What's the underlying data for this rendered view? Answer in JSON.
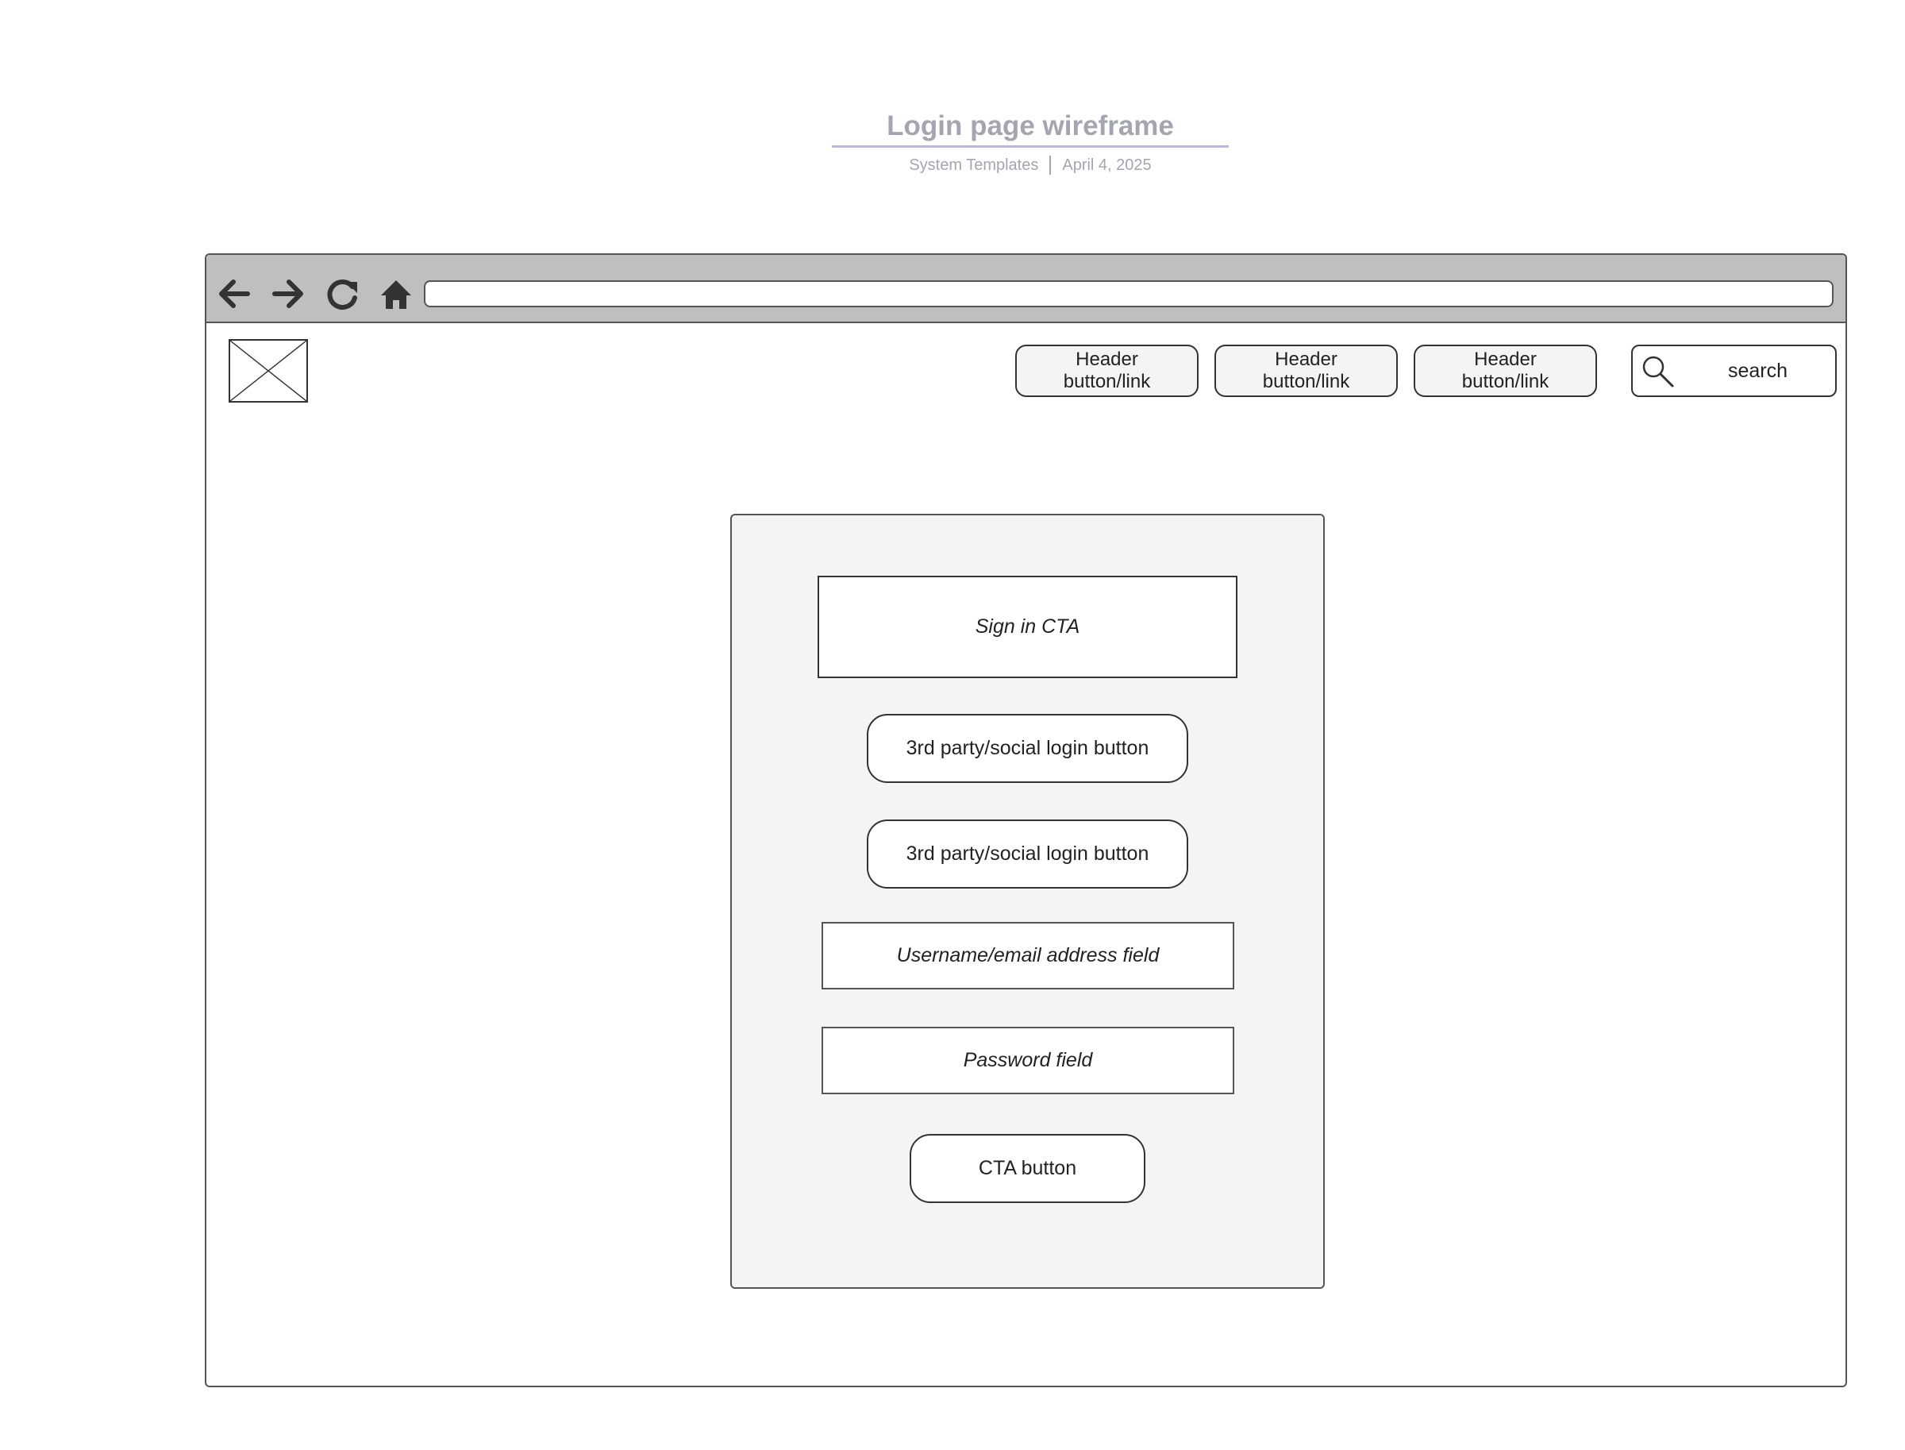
{
  "diagram": {
    "title": "Login page wireframe",
    "source": "System Templates",
    "date": "April 4, 2025"
  },
  "browser": {
    "icons": [
      "back-arrow-icon",
      "forward-arrow-icon",
      "reload-icon",
      "home-icon"
    ],
    "address_value": ""
  },
  "header": {
    "logo_icon": "image-placeholder-icon",
    "buttons": [
      {
        "label": "Header button/link"
      },
      {
        "label": "Header button/link"
      },
      {
        "label": "Header button/link"
      }
    ],
    "search": {
      "icon": "search-icon",
      "label": "search"
    }
  },
  "login": {
    "sign_in_cta": "Sign in CTA",
    "social_buttons": [
      {
        "label": "3rd party/social login button"
      },
      {
        "label": "3rd party/social login button"
      }
    ],
    "username_field": "Username/email address field",
    "password_field": "Password field",
    "cta_button": "CTA button"
  },
  "colors": {
    "title_text": "#a3a6b1",
    "title_rule": "#b9b7dd",
    "browser_bar": "#bfbfbf",
    "card_fill": "#f4f4f4",
    "outline": "#333333"
  }
}
